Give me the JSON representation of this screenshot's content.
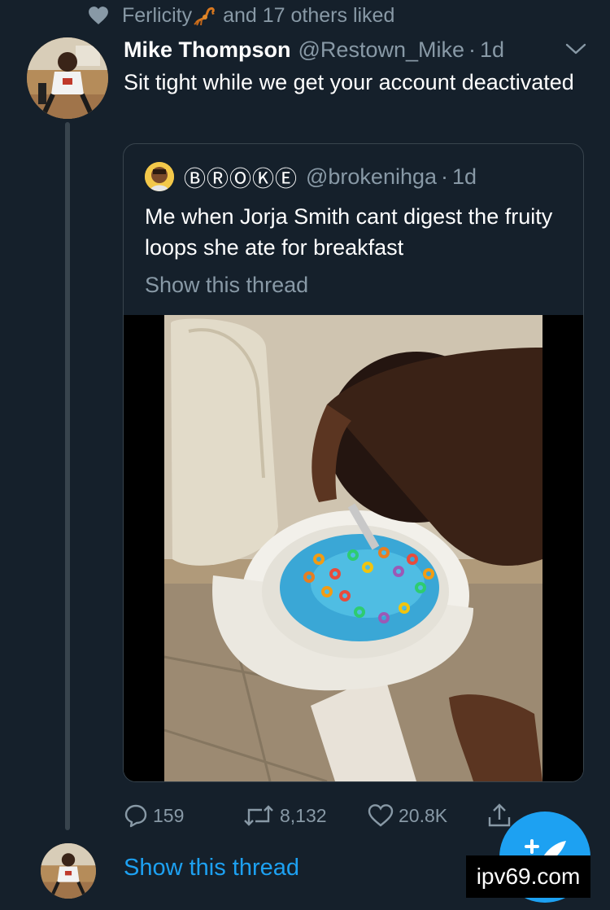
{
  "social_context": {
    "liker": "Ferlicity",
    "liker_emoji": "scorpion-emoji",
    "others_text": "and 17 others liked",
    "icon": "heart-icon"
  },
  "tweet": {
    "author_name": "Mike Thompson",
    "author_handle": "@Restown_Mike",
    "separator": "·",
    "time": "1d",
    "text": "Sit tight while we get your account deactivated",
    "menu_icon": "chevron-down-icon"
  },
  "quoted": {
    "author_name": "ⒷⓇⓄⓀⒺ",
    "author_handle": "@brokenihga",
    "separator": "·",
    "time": "1d",
    "text": "Me when Jorja Smith cant digest the fruity loops she ate for breakfast",
    "show_thread": "Show this thread"
  },
  "actions": {
    "replies": "159",
    "retweets": "8,132",
    "likes": "20.8K",
    "reply_icon": "reply-icon",
    "retweet_icon": "retweet-icon",
    "like_icon": "heart-outline-icon",
    "share_icon": "share-icon"
  },
  "show_thread": "Show this thread",
  "fab_icon": "compose-tweet-icon",
  "watermark": "ipv69.com",
  "colors": {
    "background": "#15202b",
    "accent": "#1da1f2",
    "muted": "#8899a6",
    "border": "#38444d"
  }
}
